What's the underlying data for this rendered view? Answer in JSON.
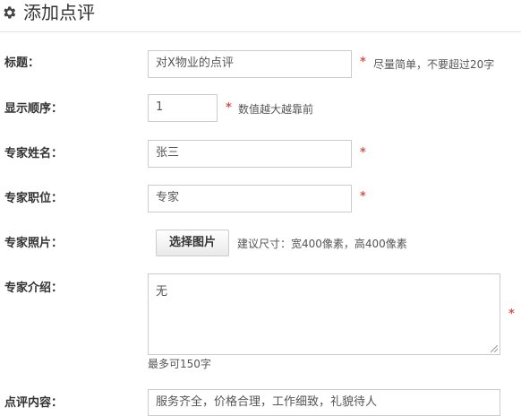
{
  "header": {
    "title": "添加点评",
    "icon": "gear-icon"
  },
  "form": {
    "title_row": {
      "label": "标题：",
      "value": "对X物业的点评",
      "required": "*",
      "hint": "尽量简单，不要超过20字"
    },
    "order_row": {
      "label": "显示顺序：",
      "value": "1",
      "required": "*",
      "hint": "数值越大越靠前"
    },
    "name_row": {
      "label": "专家姓名：",
      "value": "张三",
      "required": "*"
    },
    "position_row": {
      "label": "专家职位：",
      "value": "专家",
      "required": "*"
    },
    "photo_row": {
      "label": "专家照片：",
      "button": "选择图片",
      "hint": "建议尺寸：宽400像素，高400像素"
    },
    "intro_row": {
      "label": "专家介绍：",
      "value": "无",
      "required": "*",
      "hint": "最多可150字"
    },
    "content_row": {
      "label": "点评内容：",
      "value": "服务齐全，价格合理，工作细致，礼貌待人"
    }
  },
  "colors": {
    "required": "#d9534f",
    "border": "#cccccc"
  }
}
